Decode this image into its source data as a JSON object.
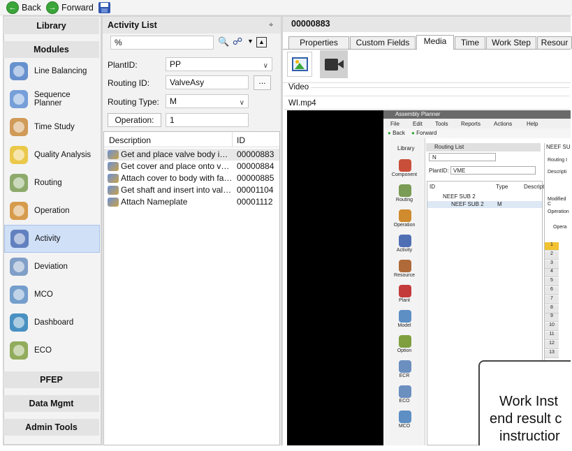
{
  "toolbar": {
    "back_label": "Back",
    "forward_label": "Forward"
  },
  "nav": {
    "library": "Library",
    "modules": "Modules",
    "items": [
      {
        "label": "Line Balancing",
        "icon": "line-balancing-icon"
      },
      {
        "label": "Sequence Planner",
        "icon": "sequence-planner-icon"
      },
      {
        "label": "Time Study",
        "icon": "time-study-icon"
      },
      {
        "label": "Quality Analysis",
        "icon": "quality-analysis-icon"
      },
      {
        "label": "Routing",
        "icon": "routing-icon"
      },
      {
        "label": "Operation",
        "icon": "operation-icon"
      },
      {
        "label": "Activity",
        "icon": "activity-icon",
        "selected": true
      },
      {
        "label": "Deviation",
        "icon": "deviation-icon"
      },
      {
        "label": "MCO",
        "icon": "mco-icon"
      },
      {
        "label": "Dashboard",
        "icon": "dashboard-icon"
      },
      {
        "label": "ECO",
        "icon": "eco-icon"
      }
    ],
    "pfep": "PFEP",
    "data_mgmt": "Data Mgmt",
    "admin_tools": "Admin Tools"
  },
  "activity_list": {
    "title": "Activity List",
    "search_value": "%",
    "plant_label": "PlantID:",
    "plant_value": "PP",
    "routing_label": "Routing ID:",
    "routing_value": "ValveAsy",
    "browse_label": "...",
    "routing_type_label": "Routing Type:",
    "routing_type_value": "M",
    "operation_button": "Operation:",
    "operation_value": "1",
    "columns": [
      "Description",
      "ID"
    ],
    "rows": [
      {
        "description": "Get and place valve body into fi...",
        "id": "00000883",
        "selected": true
      },
      {
        "description": "Get cover and place onto valve...",
        "id": "00000884"
      },
      {
        "description": "Attach cover to body with faste...",
        "id": "00000885"
      },
      {
        "description": "Get shaft and insert into valve b...",
        "id": "00001104"
      },
      {
        "description": "Attach Nameplate",
        "id": "00001112"
      }
    ]
  },
  "detail": {
    "title": "00000883",
    "tabs": [
      "Properties",
      "Custom Fields",
      "Media",
      "Time",
      "Work Step",
      "Resour"
    ],
    "active_tab": "Media",
    "video_label": "Video",
    "file_name": "WI.mp4"
  },
  "embedded": {
    "title": "Assembly Planner",
    "menu": [
      "File",
      "Edit",
      "Tools",
      "Reports",
      "Actions",
      "Help"
    ],
    "back": "Back",
    "forward": "Forward",
    "library": "Library",
    "routing_list": "Routing List",
    "search_value": "N",
    "plant_label": "PlantID:",
    "plant_value": "VME",
    "columns": [
      "ID",
      "Type",
      "Descripti"
    ],
    "tree_rows": [
      {
        "id": "NEEF SUB 2",
        "type": ""
      },
      {
        "id": "NEEF SUB 2",
        "type": "M"
      }
    ],
    "side_items": [
      "Component",
      "Routing",
      "Operation",
      "Activity",
      "Resource",
      "Plant",
      "Model",
      "Option",
      "ECR",
      "ECO",
      "MCO"
    ],
    "right_header": "NEEF SU",
    "right_labels": [
      "Routing I",
      "Descripti",
      "Modified C",
      "Operation"
    ],
    "oper_tab": "Opera",
    "row_numbers": [
      "1",
      "2",
      "3",
      "4",
      "5",
      "6",
      "7",
      "8",
      "9",
      "10",
      "11",
      "12",
      "13"
    ],
    "overlay_lines": [
      "Work Inst",
      "end result c",
      "instructior"
    ]
  }
}
